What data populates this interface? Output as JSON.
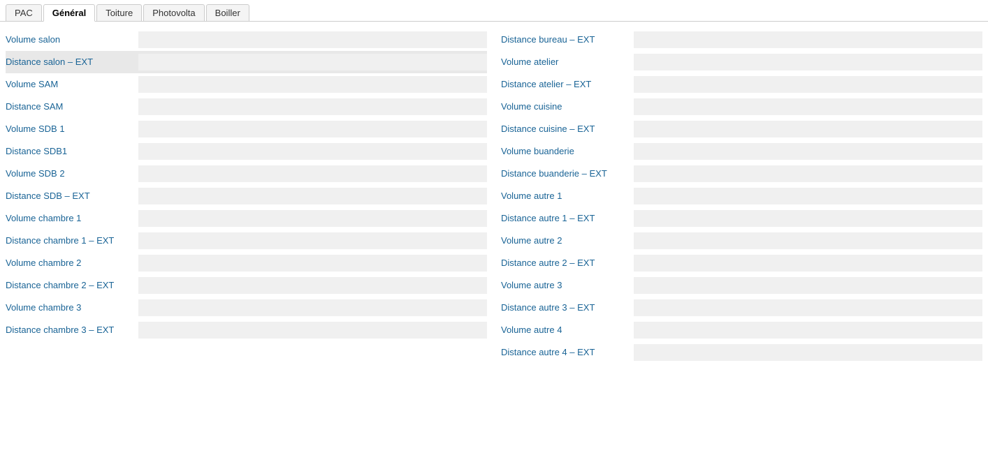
{
  "tabs": [
    {
      "label": "PAC",
      "active": false
    },
    {
      "label": "Général",
      "active": true
    },
    {
      "label": "Toiture",
      "active": false
    },
    {
      "label": "Photovolta",
      "active": false
    },
    {
      "label": "Boiller",
      "active": false
    }
  ],
  "left_rows": [
    {
      "label": "Volume salon",
      "value": "",
      "highlight": false
    },
    {
      "label": "Distance salon – EXT",
      "value": "",
      "highlight": true
    },
    {
      "label": "Volume SAM",
      "value": "",
      "highlight": false
    },
    {
      "label": "Distance SAM",
      "value": "",
      "highlight": false
    },
    {
      "label": "Volume SDB 1",
      "value": "",
      "highlight": false
    },
    {
      "label": "Distance SDB1",
      "value": "",
      "highlight": false
    },
    {
      "label": "Volume SDB 2",
      "value": "",
      "highlight": false
    },
    {
      "label": "Distance SDB – EXT",
      "value": "",
      "highlight": false
    },
    {
      "label": "Volume chambre 1",
      "value": "",
      "highlight": false
    },
    {
      "label": "Distance chambre 1 – EXT",
      "value": "",
      "highlight": false,
      "multiline": true
    },
    {
      "label": "Volume chambre 2",
      "value": "",
      "highlight": false
    },
    {
      "label": "Distance chambre 2 – EXT",
      "value": "",
      "highlight": false,
      "multiline": true
    },
    {
      "label": "Volume chambre 3",
      "value": "",
      "highlight": false
    },
    {
      "label": "Distance chambre 3 – EXT",
      "value": "",
      "highlight": false,
      "multiline": true
    }
  ],
  "right_rows": [
    {
      "label": "Distance bureau – EXT",
      "value": "",
      "highlight": false
    },
    {
      "label": "Volume atelier",
      "value": "",
      "highlight": false
    },
    {
      "label": "Distance atelier – EXT",
      "value": "",
      "highlight": false
    },
    {
      "label": "Volume cuisine",
      "value": "",
      "highlight": false
    },
    {
      "label": "Distance cuisine – EXT",
      "value": "",
      "highlight": false
    },
    {
      "label": "Volume buanderie",
      "value": "",
      "highlight": false
    },
    {
      "label": "Distance buanderie – EXT",
      "value": "",
      "highlight": false,
      "multiline": true
    },
    {
      "label": "Volume autre 1",
      "value": "",
      "highlight": false
    },
    {
      "label": "Distance autre 1 – EXT",
      "value": "",
      "highlight": false
    },
    {
      "label": "Volume autre 2",
      "value": "",
      "highlight": false
    },
    {
      "label": "Distance autre 2 – EXT",
      "value": "",
      "highlight": false
    },
    {
      "label": "Volume autre 3",
      "value": "",
      "highlight": false
    },
    {
      "label": "Distance autre 3 – EXT",
      "value": "",
      "highlight": false
    },
    {
      "label": "Volume autre 4",
      "value": "",
      "highlight": false
    },
    {
      "label": "Distance autre 4 – EXT",
      "value": "",
      "highlight": false
    }
  ]
}
